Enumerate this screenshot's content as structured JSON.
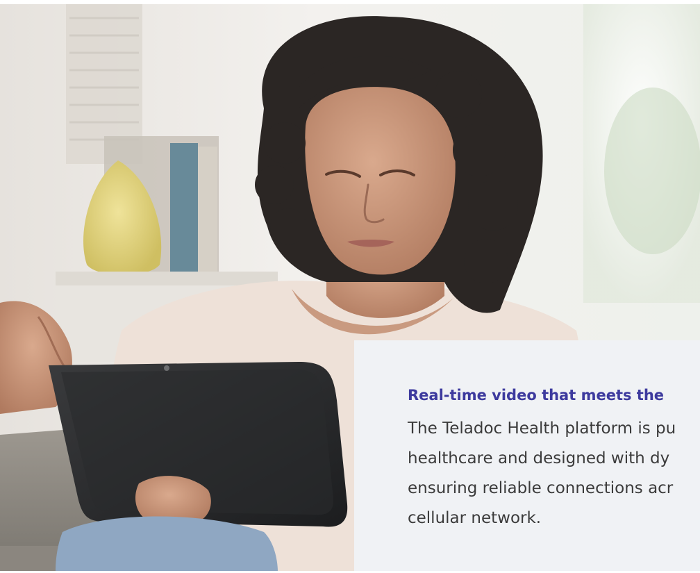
{
  "hero": {
    "image_name": "woman-using-tablet-photo"
  },
  "card": {
    "heading": "Real-time video that meets the",
    "body_lines": [
      "The Teladoc Health platform is pu",
      "healthcare and designed with dy",
      "ensuring reliable connections acr",
      "cellular network."
    ]
  },
  "colors": {
    "heading": "#3d3a9e",
    "body_text": "#3b3b3b",
    "card_background": "#f0f2f5"
  }
}
